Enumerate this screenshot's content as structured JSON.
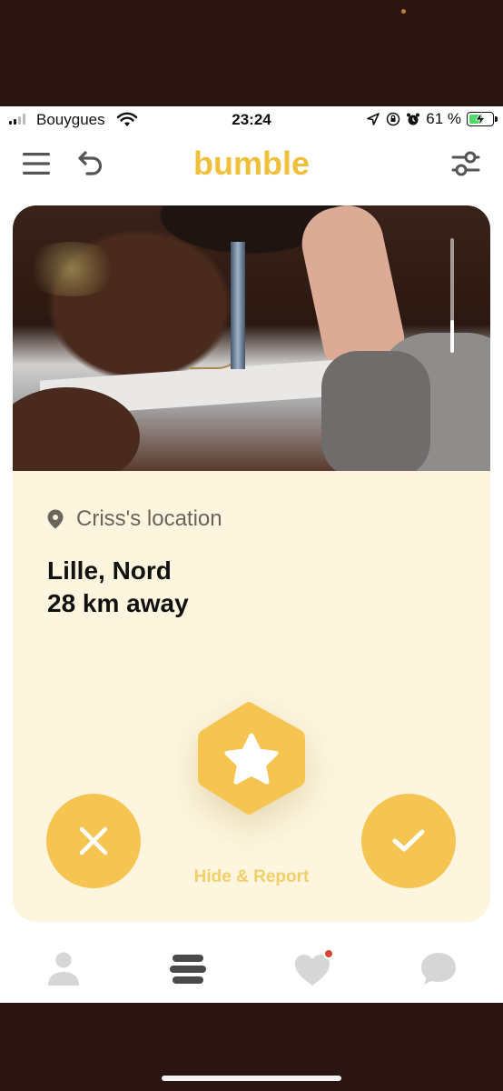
{
  "status_bar": {
    "carrier": "Bouygues",
    "time": "23:24",
    "battery_percent": "61 %",
    "battery_level": 0.61,
    "icons": [
      "signal-icon",
      "wifi-icon",
      "location-arrow-icon",
      "orientation-lock-icon",
      "alarm-icon",
      "battery-charging-icon"
    ]
  },
  "header": {
    "logo": "bumble",
    "icons": [
      "menu-icon",
      "undo-icon",
      "filter-icon"
    ]
  },
  "profile": {
    "location_label": "Criss's location",
    "city": "Lille, Nord",
    "distance": "28 km away"
  },
  "actions": {
    "hide_report": "Hide & Report",
    "icons": [
      "pass-x-icon",
      "superswipe-star-icon",
      "like-check-icon"
    ]
  },
  "bottom_nav": {
    "items": [
      "profile-icon",
      "people-icon",
      "liked-you-icon",
      "chat-icon"
    ],
    "liked_has_badge": true
  },
  "colors": {
    "brand": "#f0c03c",
    "button": "#f5c451",
    "card_bg": "#fdf5dd",
    "badge": "#d6452e",
    "frame": "#2a1512"
  }
}
